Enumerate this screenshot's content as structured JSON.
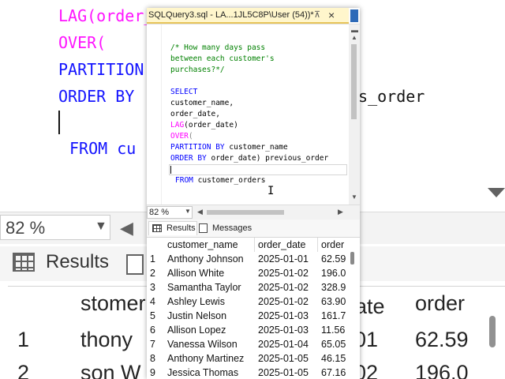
{
  "background": {
    "code_lines": [
      {
        "text": "LAG(order_",
        "color": "#ff00ff"
      },
      {
        "text": "OVER(",
        "color": "#ff00ff"
      },
      {
        "text": "PARTITION B",
        "color": "#0000ff"
      },
      {
        "text": "ORDER BY",
        "color": "#0000ff"
      }
    ],
    "previous_order_fragment": "us_order",
    "from_line": "FROM cu",
    "zoom": "82 %",
    "results_tab": "Results",
    "grid_headers": [
      "stomer",
      "ate",
      "order"
    ],
    "grid_rows": [
      {
        "num": "1",
        "name": "thony",
        "date": "-01",
        "prev": "62.59"
      },
      {
        "num": "2",
        "name": "son W",
        "date": "-02",
        "prev": "196.0"
      }
    ]
  },
  "window": {
    "tab_title": "SQLQuery3.sql - LA...1JL5C8P\\User (54))*",
    "pin_glyph": "⊼",
    "close_glyph": "×"
  },
  "editor": {
    "comment_lines": [
      "/* How many days pass",
      "between each customer's",
      "purchases?*/"
    ],
    "select_kw": "SELECT",
    "col_customer": "customer_name,",
    "col_order_date": "order_date,",
    "lag_fn": "LAG",
    "lag_arg": "(order_date)",
    "over_fn": "OVER",
    "over_paren": "(",
    "partition_kw": "PARTITION BY",
    "partition_col": "customer_name",
    "orderby_kw": "ORDER BY",
    "orderby_rest": "order_date) previous_order",
    "from_kw": "FROM",
    "from_table": "customer_orders"
  },
  "toolbar": {
    "zoom": "82 %"
  },
  "results": {
    "tab_results": "Results",
    "tab_messages": "Messages",
    "headers": [
      "customer_name",
      "order_date",
      "order"
    ],
    "rows": [
      {
        "num": "1",
        "name": "Anthony Johnson",
        "date": "2025-01-01",
        "prev": "62.59"
      },
      {
        "num": "2",
        "name": "Allison White",
        "date": "2025-01-02",
        "prev": "196.0"
      },
      {
        "num": "3",
        "name": "Samantha Taylor",
        "date": "2025-01-02",
        "prev": "328.9"
      },
      {
        "num": "4",
        "name": "Ashley Lewis",
        "date": "2025-01-02",
        "prev": "63.90"
      },
      {
        "num": "5",
        "name": "Justin Nelson",
        "date": "2025-01-03",
        "prev": "161.7"
      },
      {
        "num": "6",
        "name": "Allison Lopez",
        "date": "2025-01-03",
        "prev": "11.56"
      },
      {
        "num": "7",
        "name": "Vanessa Wilson",
        "date": "2025-01-04",
        "prev": "65.05"
      },
      {
        "num": "8",
        "name": "Anthony Martinez",
        "date": "2025-01-05",
        "prev": "46.15"
      },
      {
        "num": "9",
        "name": "Jessica Thomas",
        "date": "2025-01-05",
        "prev": "67.16"
      }
    ]
  }
}
